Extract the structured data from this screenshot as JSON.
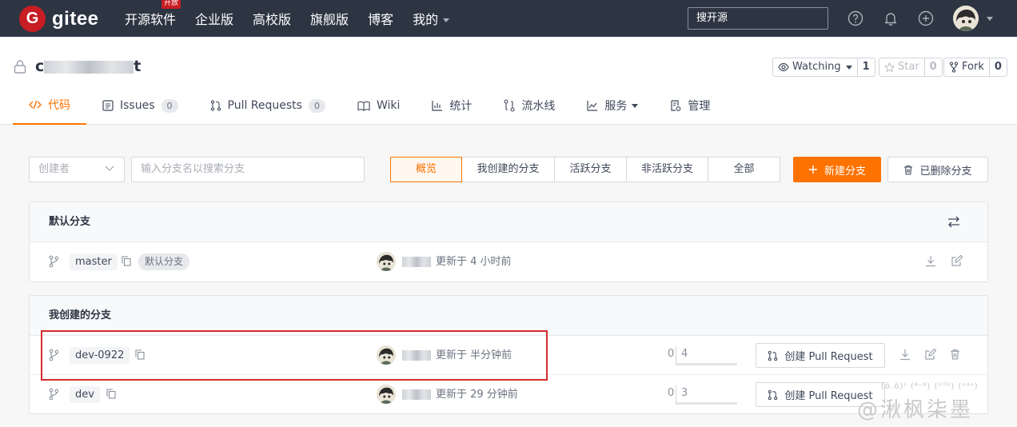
{
  "topbar": {
    "logo_letter": "G",
    "logo_text": "gitee",
    "nav": [
      {
        "label": "开源软件",
        "badge": "开放"
      },
      {
        "label": "企业版"
      },
      {
        "label": "高校版"
      },
      {
        "label": "旗舰版"
      },
      {
        "label": "博客"
      },
      {
        "label": "我的"
      }
    ],
    "search_placeholder": "搜开源"
  },
  "repo": {
    "name_start": "c",
    "name_end": "t",
    "watching_label": "Watching",
    "watching_count": "1",
    "star_label": "Star",
    "star_count": "0",
    "fork_label": "Fork",
    "fork_count": "0"
  },
  "tabs": [
    {
      "label": "代码",
      "icon": "code-icon"
    },
    {
      "label": "Issues",
      "count": "0",
      "icon": "issues-icon"
    },
    {
      "label": "Pull Requests",
      "count": "0",
      "icon": "pull-request-icon"
    },
    {
      "label": "Wiki",
      "icon": "book-icon"
    },
    {
      "label": "统计",
      "icon": "bar-chart-icon"
    },
    {
      "label": "流水线",
      "icon": "pipeline-icon"
    },
    {
      "label": "服务",
      "icon": "line-chart-icon"
    },
    {
      "label": "管理",
      "icon": "settings-doc-icon"
    }
  ],
  "filters": {
    "creator_placeholder": "创建者",
    "branch_search_placeholder": "输入分支名以搜索分支",
    "options": [
      "概览",
      "我创建的分支",
      "活跃分支",
      "非活跃分支",
      "全部"
    ],
    "active_option": "概览",
    "new_branch_label": "新建分支",
    "deleted_branches_label": "已删除分支"
  },
  "default_branch_section": {
    "title": "默认分支",
    "branch": {
      "name": "master",
      "tag": "默认分支",
      "updated": "更新于 4 小时前"
    }
  },
  "my_branches_section": {
    "title": "我创建的分支",
    "branches": [
      {
        "name": "dev-0922",
        "updated": "更新于 半分钟前",
        "behind": "0",
        "ahead": "4",
        "pr_label": "创建 Pull Request"
      },
      {
        "name": "dev",
        "updated": "更新于 29 分钟前",
        "behind": "0",
        "ahead": "3",
        "pr_label": "创建 Pull Request"
      }
    ]
  },
  "watermark": {
    "line1": "(ō.ō)ᶻ (ᶿᵕᶿ) (ᵁᵀᵁ) (ᵒᵈᵒ)",
    "line2": "@湫枫柒墨"
  },
  "colors": {
    "accent": "#fe7300",
    "topbar": "#2d3543",
    "logo_red": "#c71d23",
    "highlight": "#d62a2a"
  }
}
